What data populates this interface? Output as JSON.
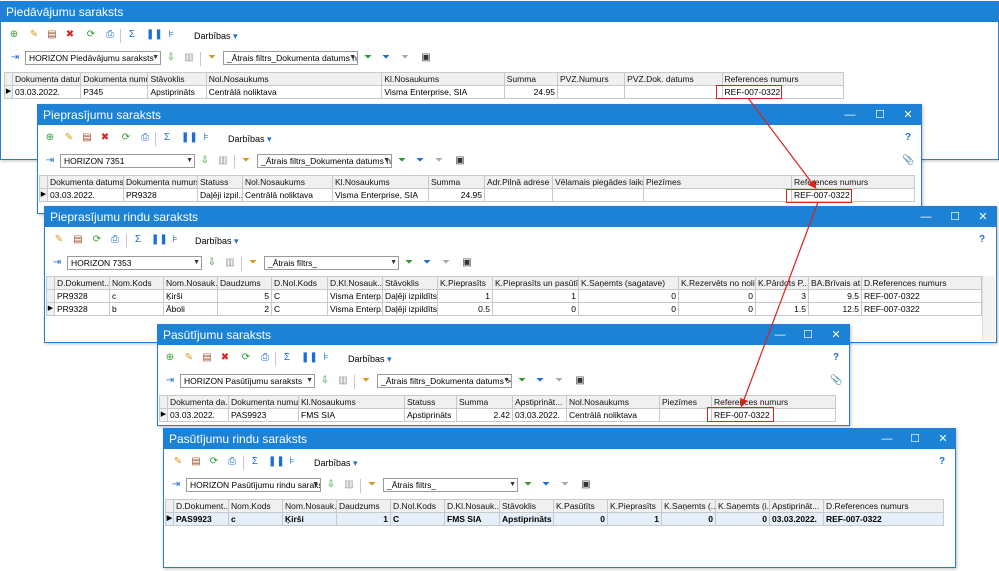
{
  "windows": {
    "piedavajumi": {
      "title": "Piedāvājumu saraksts",
      "actions_label": "Darbības",
      "saved_filter": "HORIZON Piedāvājumu saraksts",
      "quick_filter": "_Ātrais filtrs_Dokumenta datums no",
      "columns": [
        "Dokumenta datums",
        "Dokumenta numurs",
        "Stāvoklis",
        "Nol.Nosaukums",
        "Kl.Nosaukums",
        "Summa",
        "PVZ.Numurs",
        "PVZ.Dok. datums",
        "References numurs"
      ],
      "rows": [
        [
          "03.03.2022.",
          "P345",
          "Apstiprināts",
          "Centrālā noliktava",
          "Visma Enterprise, SIA",
          "24.95",
          "",
          "",
          "REF-007-0322"
        ]
      ]
    },
    "pieprasijumi": {
      "title": "Pieprasījumu saraksts",
      "actions_label": "Darbības",
      "saved_filter": "HORIZON 7351",
      "quick_filter": "_Ātrais filtrs_Dokumenta datums no",
      "columns": [
        "Dokumenta datums",
        "Dokumenta numurs",
        "Statuss",
        "Nol.Nosaukums",
        "Kl.Nosaukums",
        "Summa",
        "Adr.Pilnā adrese",
        "Vēlamais piegādes laiks",
        "Piezīmes",
        "References numurs"
      ],
      "rows": [
        [
          "03.03.2022.",
          "PR9328",
          "Daļēji izpil...",
          "Centrālā noliktava",
          "Visma Enterprise, SIA",
          "24.95",
          "",
          "",
          "",
          "REF-007-0322"
        ]
      ]
    },
    "pieprasijumu_rindas": {
      "title": "Pieprasījumu rindu saraksts",
      "actions_label": "Darbības",
      "saved_filter": "HORIZON 7353",
      "quick_filter": "_Ātrais filtrs_",
      "columns": [
        "D.Dokument...",
        "Nom.Kods",
        "Nom.Nosauk...",
        "Daudzums",
        "D.Nol.Kods",
        "D.Kl.Nosauk...",
        "Stāvoklis",
        "K.Pieprasīts",
        "K.Pieprasīts un pasūtīts",
        "K.Saņemts (sagatave)",
        "K.Rezervēts no noli...",
        "K.Pārdots P...",
        "BA.Brīvais at...",
        "D.References numurs"
      ],
      "rows": [
        [
          "PR9328",
          "c",
          "Ķirši",
          "5",
          "C",
          "Visma Enterp...",
          "Daļēji izpildīts",
          "1",
          "1",
          "0",
          "0",
          "3",
          "9.5",
          "REF-007-0322"
        ],
        [
          "PR9328",
          "b",
          "Āboli",
          "2",
          "C",
          "Visma Enterp...",
          "Daļēji izpildīts",
          "0.5",
          "0",
          "0",
          "0",
          "1.5",
          "12.5",
          "REF-007-0322"
        ]
      ]
    },
    "pasutijumi": {
      "title": "Pasūtījumu saraksts",
      "actions_label": "Darbības",
      "saved_filter": "HORIZON Pasūtījumu saraksts",
      "quick_filter": "_Ātrais filtrs_Dokumenta datums >=",
      "columns": [
        "Dokumenta da...",
        "Dokumenta numurs",
        "Kl.Nosaukums",
        "Statuss",
        "Summa",
        "Apstiprināt...",
        "Nol.Nosaukums",
        "Piezīmes",
        "References numurs"
      ],
      "rows": [
        [
          "03.03.2022.",
          "PAS9923",
          "FMS SIA",
          "Apstiprināts",
          "2.42",
          "03.03.2022.",
          "Centrālā noliktava",
          "",
          "REF-007-0322"
        ]
      ]
    },
    "pasutijumu_rindas": {
      "title": "Pasūtījumu rindu saraksts",
      "actions_label": "Darbības",
      "saved_filter": "HORIZON Pasūtījumu rindu saraksts",
      "quick_filter": "_Ātrais filtrs_",
      "columns": [
        "D.Dokument...",
        "Nom.Kods",
        "Nom.Nosauk...",
        "Daudzums",
        "D.Nol.Kods",
        "D.Kl.Nosauk...",
        "Stāvoklis",
        "K.Pasūtīts",
        "K.Pieprasīts",
        "K.Saņemts (...",
        "K.Saņemts (i...",
        "Apstiprināt...",
        "D.References numurs"
      ],
      "rows": [
        [
          "PAS9923",
          "c",
          "Ķirši",
          "1",
          "C",
          "FMS SIA",
          "Apstiprināts",
          "0",
          "1",
          "0",
          "0",
          "03.03.2022.",
          "REF-007-0322"
        ]
      ]
    }
  },
  "colors": {
    "titlebar": "#1c82d6",
    "highlight": "#d9231b",
    "selected_row": "#e4eff9"
  },
  "icons": [
    "new-icon",
    "edit-icon",
    "copy-icon",
    "delete-icon",
    "refresh-icon",
    "print-icon",
    "sum-icon",
    "columns-icon",
    "tree-icon",
    "filter-icon",
    "help-icon",
    "attachment-icon"
  ]
}
